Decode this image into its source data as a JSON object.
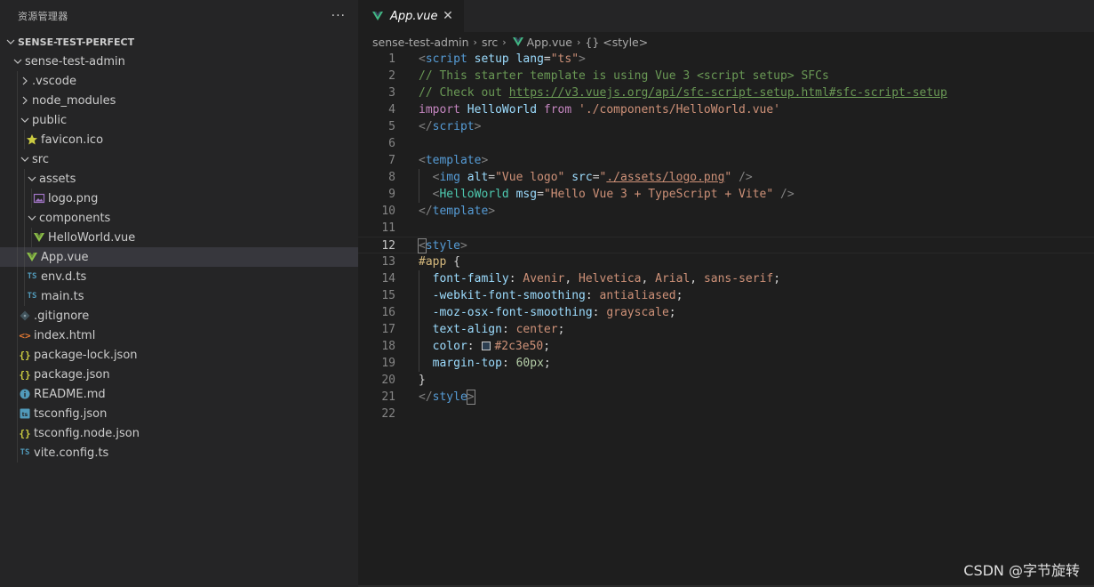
{
  "sidebar": {
    "title": "资源管理器",
    "more": "···",
    "root": "SENSE-TEST-PERFECT",
    "items": [
      {
        "label": "sense-test-admin",
        "depth": 1,
        "kind": "folder-open",
        "icon": "chevron-down"
      },
      {
        "label": ".vscode",
        "depth": 2,
        "kind": "folder-closed",
        "icon": "chevron-right"
      },
      {
        "label": "node_modules",
        "depth": 2,
        "kind": "folder-closed",
        "icon": "chevron-right"
      },
      {
        "label": "public",
        "depth": 2,
        "kind": "folder-open",
        "icon": "chevron-down"
      },
      {
        "label": "favicon.ico",
        "depth": 3,
        "kind": "file",
        "icon": "star-icon"
      },
      {
        "label": "src",
        "depth": 2,
        "kind": "folder-open",
        "icon": "chevron-down"
      },
      {
        "label": "assets",
        "depth": 3,
        "kind": "folder-open",
        "icon": "chevron-down"
      },
      {
        "label": "logo.png",
        "depth": 4,
        "kind": "file",
        "icon": "image-icon"
      },
      {
        "label": "components",
        "depth": 3,
        "kind": "folder-open",
        "icon": "chevron-down"
      },
      {
        "label": "HelloWorld.vue",
        "depth": 4,
        "kind": "file",
        "icon": "vue-icon"
      },
      {
        "label": "App.vue",
        "depth": 3,
        "kind": "file",
        "icon": "vue-icon",
        "selected": true
      },
      {
        "label": "env.d.ts",
        "depth": 3,
        "kind": "file",
        "icon": "ts-icon"
      },
      {
        "label": "main.ts",
        "depth": 3,
        "kind": "file",
        "icon": "ts-icon"
      },
      {
        "label": ".gitignore",
        "depth": 2,
        "kind": "file",
        "icon": "git-icon"
      },
      {
        "label": "index.html",
        "depth": 2,
        "kind": "file",
        "icon": "html-icon"
      },
      {
        "label": "package-lock.json",
        "depth": 2,
        "kind": "file",
        "icon": "json-icon"
      },
      {
        "label": "package.json",
        "depth": 2,
        "kind": "file",
        "icon": "json-icon"
      },
      {
        "label": "README.md",
        "depth": 2,
        "kind": "file",
        "icon": "info-icon"
      },
      {
        "label": "tsconfig.json",
        "depth": 2,
        "kind": "file",
        "icon": "tsconfig-icon"
      },
      {
        "label": "tsconfig.node.json",
        "depth": 2,
        "kind": "file",
        "icon": "json-icon"
      },
      {
        "label": "vite.config.ts",
        "depth": 2,
        "kind": "file",
        "icon": "ts-icon"
      }
    ]
  },
  "tab": {
    "label": "App.vue",
    "close": "✕"
  },
  "breadcrumb": {
    "parts": [
      "sense-test-admin",
      "src",
      "App.vue",
      "{} <style>"
    ],
    "sep": "›"
  },
  "editor": {
    "current_line": 12,
    "line_numbers": [
      "1",
      "2",
      "3",
      "4",
      "5",
      "6",
      "7",
      "8",
      "9",
      "10",
      "11",
      "12",
      "13",
      "14",
      "15",
      "16",
      "17",
      "18",
      "19",
      "20",
      "21",
      "22"
    ]
  },
  "code": {
    "l1": {
      "lt": "<",
      "tag": "script",
      "a1": "setup",
      "a2": "lang",
      "eq": "=",
      "v": "\"ts\"",
      "gt": ">"
    },
    "l2": "// This starter template is using Vue 3 <script setup> SFCs",
    "l3": {
      "pre": "// Check out ",
      "link": "https://v3.vuejs.org/api/sfc-script-setup.html#sfc-script-setup"
    },
    "l4": {
      "kw1": "import",
      "id": " HelloWorld ",
      "kw2": "from",
      "str": " './components/HelloWorld.vue'"
    },
    "l5": {
      "lt": "</",
      "tag": "script",
      "gt": ">"
    },
    "l7": {
      "lt": "<",
      "tag": "template",
      "gt": ">"
    },
    "l8": {
      "lt": "<",
      "tag": "img",
      "a1": "alt",
      "v1": "\"Vue logo\"",
      "a2": "src",
      "q": "\"",
      "v2": "./assets/logo.png",
      "q2": "\"",
      "end": " />"
    },
    "l9": {
      "lt": "<",
      "tag": "HelloWorld",
      "a1": "msg",
      "v1": "\"Hello Vue 3 + TypeScript + Vite\"",
      "end": " />"
    },
    "l10": {
      "lt": "</",
      "tag": "template",
      "gt": ">"
    },
    "l12": {
      "lt": "<",
      "tag": "style",
      "gt": ">"
    },
    "l13": {
      "sel": "#app",
      "brace": " {"
    },
    "l14": {
      "p": "font-family",
      "v": [
        " Avenir",
        ", ",
        "Helvetica",
        ", ",
        "Arial",
        ", ",
        "sans-serif"
      ]
    },
    "l15": {
      "p": "-webkit-font-smoothing",
      "v": " antialiased"
    },
    "l16": {
      "p": "-moz-osx-font-smoothing",
      "v": " grayscale"
    },
    "l17": {
      "p": "text-align",
      "v": " center"
    },
    "l18": {
      "p": "color",
      "v": "#2c3e50",
      "swatch_color": "#2c3e50"
    },
    "l19": {
      "p": "margin-top",
      "v": " 60px"
    },
    "l20": "}",
    "l21": {
      "lt": "</",
      "tag": "style",
      "gt": ">"
    }
  },
  "watermark": "CSDN @字节旋转",
  "colors": {
    "accent_vue": "#42b883",
    "ts_blue": "#519aba",
    "json_yellow": "#cbcb41",
    "html_orange": "#e37933"
  }
}
